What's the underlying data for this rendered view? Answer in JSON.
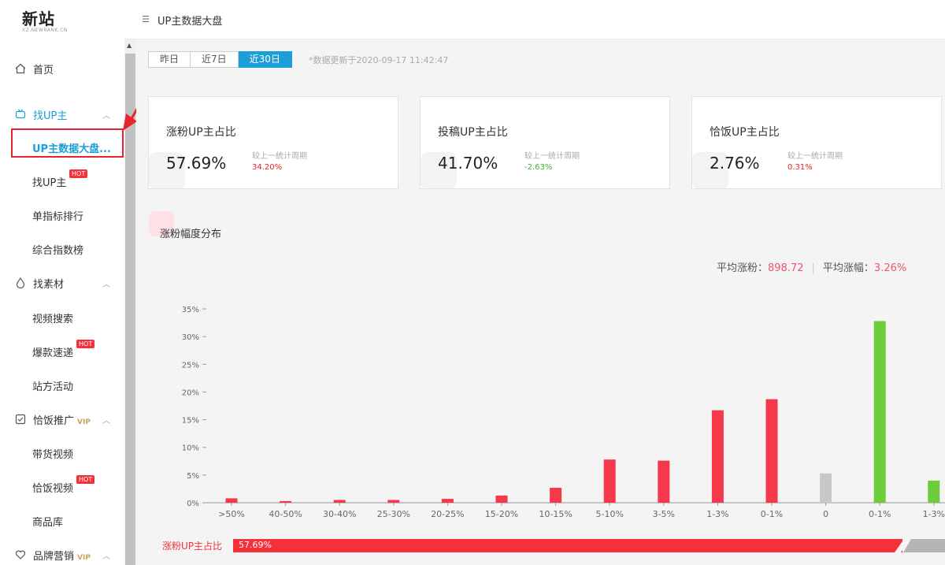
{
  "logo": {
    "main": "新站",
    "sub": "XZ.NEWRANK.CN"
  },
  "header": {
    "title": "UP主数据大盘"
  },
  "sidebar": {
    "home": "首页",
    "find_up": "找UP主",
    "up_dashboard": "UP主数据大盘...",
    "find_up_sub": "找UP主",
    "single_rank": "单指标排行",
    "overall_rank": "综合指数榜",
    "find_material": "找素材",
    "video_search": "视频搜索",
    "hot_express": "爆款速递",
    "site_activity": "站方活动",
    "qiafan_promo": "恰饭推广",
    "goods_video": "带货视频",
    "qiafan_video": "恰饭视频",
    "goods_library": "商品库",
    "brand_marketing": "品牌营销",
    "hot_badge": "HOT",
    "vip_badge": "VIP"
  },
  "tabs": [
    "昨日",
    "近7日",
    "近30日"
  ],
  "active_tab": 2,
  "update_note": "*数据更新于2020-09-17 11:42:47",
  "cards": [
    {
      "title": "涨粉UP主占比",
      "value": "57.69%",
      "cmp_label": "较上一统计周期",
      "cmp_value": "34.20%",
      "cmp_color": "#e8232b"
    },
    {
      "title": "投稿UP主占比",
      "value": "41.70%",
      "cmp_label": "较上一统计周期",
      "cmp_value": "-2.63%",
      "cmp_color": "#3cb034"
    },
    {
      "title": "恰饭UP主占比",
      "value": "2.76%",
      "cmp_label": "较上一统计周期",
      "cmp_value": "0.31%",
      "cmp_color": "#e8232b"
    }
  ],
  "section_title": "涨粉幅度分布",
  "stats": {
    "avg_fans_label": "平均涨粉：",
    "avg_fans_value": "898.72",
    "avg_rate_label": "平均涨幅：",
    "avg_rate_value": "3.26%"
  },
  "chart_data": {
    "type": "bar",
    "categories": [
      ">50%",
      "40-50%",
      "30-40%",
      "25-30%",
      "20-25%",
      "15-20%",
      "10-15%",
      "5-10%",
      "3-5%",
      "1-3%",
      "0-1%",
      "0",
      "0-1%",
      "1-3%"
    ],
    "values": [
      0.8,
      0.3,
      0.5,
      0.5,
      0.7,
      1.3,
      2.7,
      7.8,
      7.6,
      16.7,
      18.7,
      5.3,
      32.8,
      4.0
    ],
    "colors": [
      "#f5384a",
      "#f5384a",
      "#f5384a",
      "#f5384a",
      "#f5384a",
      "#f5384a",
      "#f5384a",
      "#f5384a",
      "#f5384a",
      "#f5384a",
      "#f5384a",
      "#c8c8c8",
      "#6ccc3c",
      "#6ccc3c"
    ],
    "yticks": [
      "0%",
      "5%",
      "10%",
      "15%",
      "20%",
      "25%",
      "30%",
      "35%"
    ],
    "ylim": [
      0,
      35
    ],
    "grid": false
  },
  "ratio": {
    "label": "涨粉UP主占比",
    "value": "57.69%",
    "fraction": 0.5769
  }
}
